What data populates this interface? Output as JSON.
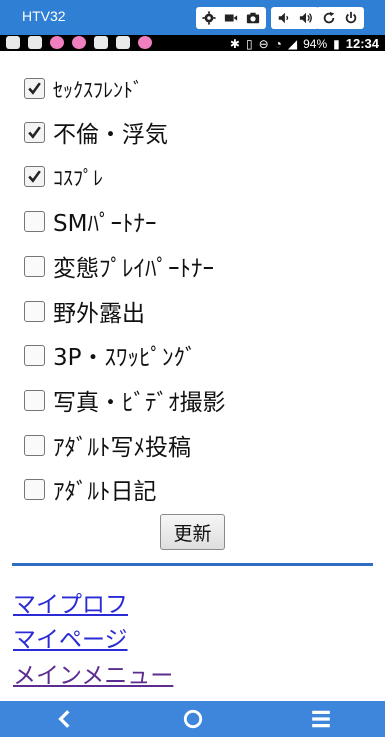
{
  "emulator": {
    "title": "HTV32",
    "controls": [
      {
        "name": "settings",
        "icon": "gear-icon"
      },
      {
        "name": "video",
        "icon": "video-camera-icon"
      },
      {
        "name": "camera",
        "icon": "camera-icon"
      },
      {
        "name": "volume-down",
        "icon": "volume-down-icon"
      },
      {
        "name": "volume-up",
        "icon": "volume-up-icon"
      },
      {
        "name": "rotate",
        "icon": "rotate-icon"
      },
      {
        "name": "power",
        "icon": "power-icon"
      }
    ]
  },
  "status_bar": {
    "battery": "94%",
    "time": "12:34"
  },
  "form": {
    "options": [
      {
        "label": "ｾｯｸｽﾌﾚﾝﾄﾞ",
        "checked": true
      },
      {
        "label": "不倫・浮気",
        "checked": true
      },
      {
        "label": "ｺｽﾌﾟﾚ",
        "checked": true
      },
      {
        "label": "SMﾊﾟｰﾄﾅｰ",
        "checked": false
      },
      {
        "label": "変態ﾌﾟﾚｲﾊﾟｰﾄﾅｰ",
        "checked": false
      },
      {
        "label": "野外露出",
        "checked": false
      },
      {
        "label": "3P・ｽﾜｯﾋﾟﾝｸﾞ",
        "checked": false
      },
      {
        "label": "写真・ﾋﾞﾃﾞｵ撮影",
        "checked": false
      },
      {
        "label": "ｱﾀﾞﾙﾄ写ﾒ投稿",
        "checked": false
      },
      {
        "label": "ｱﾀﾞﾙﾄ日記",
        "checked": false
      }
    ],
    "submit_label": "更新"
  },
  "links": [
    {
      "label": "マイプロフ"
    },
    {
      "label": "マイページ"
    },
    {
      "label": "メインメニュー"
    }
  ],
  "colors": {
    "emulator_bar": "#2f7fd4",
    "nav_bar": "#3e86dc",
    "divider": "#2f6dc2",
    "link": "#2a2bd6",
    "link_visited": "#5c2d91"
  }
}
